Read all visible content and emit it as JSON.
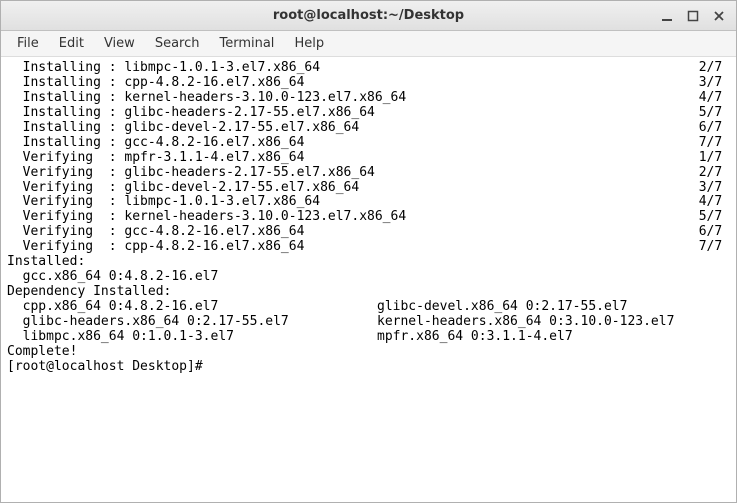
{
  "window": {
    "title": "root@localhost:~/Desktop"
  },
  "menubar": {
    "file": "File",
    "edit": "Edit",
    "view": "View",
    "search": "Search",
    "terminal": "Terminal",
    "help": "Help"
  },
  "term": {
    "actions": [
      {
        "step": "Installing",
        "pkg": "libmpc-1.0.1-3.el7.x86_64",
        "count": "2/7"
      },
      {
        "step": "Installing",
        "pkg": "cpp-4.8.2-16.el7.x86_64",
        "count": "3/7"
      },
      {
        "step": "Installing",
        "pkg": "kernel-headers-3.10.0-123.el7.x86_64",
        "count": "4/7"
      },
      {
        "step": "Installing",
        "pkg": "glibc-headers-2.17-55.el7.x86_64",
        "count": "5/7"
      },
      {
        "step": "Installing",
        "pkg": "glibc-devel-2.17-55.el7.x86_64",
        "count": "6/7"
      },
      {
        "step": "Installing",
        "pkg": "gcc-4.8.2-16.el7.x86_64",
        "count": "7/7"
      },
      {
        "step": "Verifying",
        "pkg": "mpfr-3.1.1-4.el7.x86_64",
        "count": "1/7"
      },
      {
        "step": "Verifying",
        "pkg": "glibc-headers-2.17-55.el7.x86_64",
        "count": "2/7"
      },
      {
        "step": "Verifying",
        "pkg": "glibc-devel-2.17-55.el7.x86_64",
        "count": "3/7"
      },
      {
        "step": "Verifying",
        "pkg": "libmpc-1.0.1-3.el7.x86_64",
        "count": "4/7"
      },
      {
        "step": "Verifying",
        "pkg": "kernel-headers-3.10.0-123.el7.x86_64",
        "count": "5/7"
      },
      {
        "step": "Verifying",
        "pkg": "gcc-4.8.2-16.el7.x86_64",
        "count": "6/7"
      },
      {
        "step": "Verifying",
        "pkg": "cpp-4.8.2-16.el7.x86_64",
        "count": "7/7"
      }
    ],
    "installed_header": "Installed:",
    "installed_line": "  gcc.x86_64 0:4.8.2-16.el7",
    "dep_header": "Dependency Installed:",
    "dep_rows": [
      {
        "c1": "  cpp.x86_64 0:4.8.2-16.el7",
        "c2": "glibc-devel.x86_64 0:2.17-55.el7"
      },
      {
        "c1": "  glibc-headers.x86_64 0:2.17-55.el7",
        "c2": "kernel-headers.x86_64 0:3.10.0-123.el7"
      },
      {
        "c1": "  libmpc.x86_64 0:1.0.1-3.el7",
        "c2": "mpfr.x86_64 0:3.1.1-4.el7"
      }
    ],
    "complete": "Complete!",
    "prompt": "[root@localhost Desktop]# "
  }
}
